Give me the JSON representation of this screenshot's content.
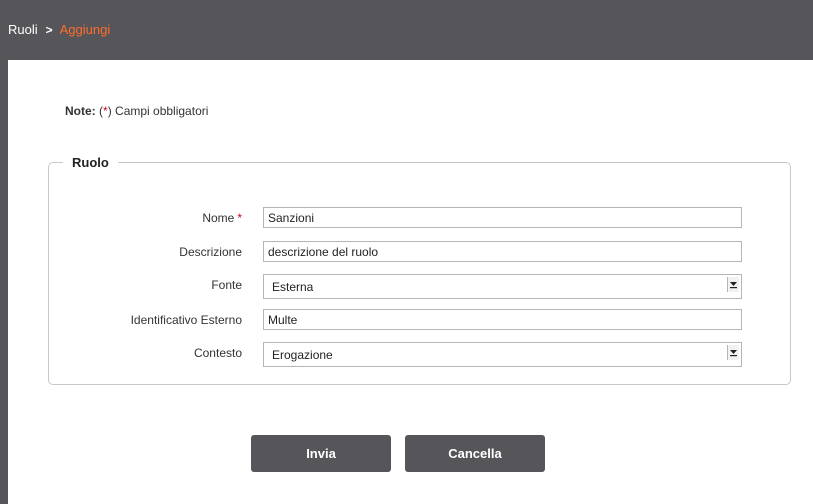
{
  "breadcrumb": {
    "root": "Ruoli",
    "separator": ">",
    "current": "Aggiungi"
  },
  "note": {
    "label": "Note:",
    "open": "(",
    "star": "*",
    "close": ")",
    "text": " Campi obbligatori"
  },
  "section": {
    "title": "Ruolo"
  },
  "form": {
    "required_marker": "*",
    "nome": {
      "label": "Nome",
      "value": "Sanzioni"
    },
    "descrizione": {
      "label": "Descrizione",
      "value": "descrizione del ruolo"
    },
    "fonte": {
      "label": "Fonte",
      "value": "Esterna"
    },
    "identificativo": {
      "label": "Identificativo Esterno",
      "value": "Multe"
    },
    "contesto": {
      "label": "Contesto",
      "value": "Erogazione"
    }
  },
  "buttons": {
    "submit": "Invia",
    "cancel": "Cancella"
  },
  "colors": {
    "bar": "#55555a",
    "accent": "#ff6d2e",
    "required": "#d0021b"
  }
}
